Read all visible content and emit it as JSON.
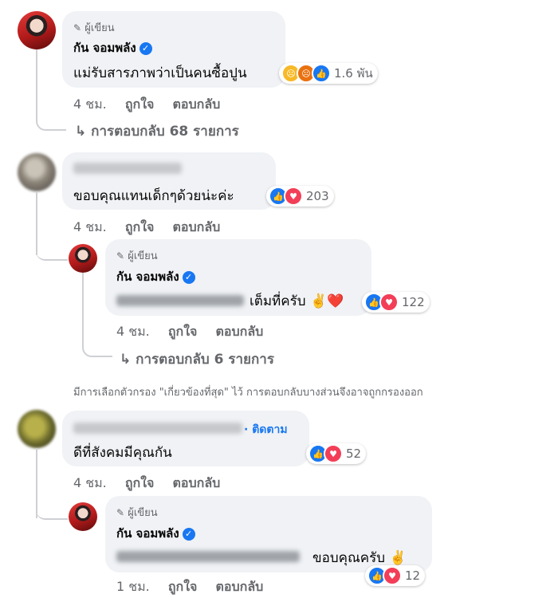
{
  "author_label": "ผู้เขียน",
  "page_name": "กัน จอมพลัง",
  "like_label": "ถูกใจ",
  "reply_label": "ตอบกลับ",
  "comment1": {
    "text": "แม่รับสารภาพว่าเป็นคนซื้อปูน",
    "time": "4 ชม.",
    "reactions_count": "1.6 พัน",
    "replies_link": "การตอบกลับ 68 รายการ"
  },
  "comment2": {
    "text": "ขอบคุณแทนเด็กๆด้วยน่ะค่ะ",
    "time": "4 ชม.",
    "reactions_count": "203",
    "reply": {
      "text": "เต็มที่ครับ ✌️❤️",
      "time": "4 ชม.",
      "reactions_count": "122",
      "replies_link": "การตอบกลับ 6 รายการ"
    }
  },
  "filter_note": "มีการเลือกตัวกรอง \"เกี่ยวข้องที่สุด\" ไว้ การตอบกลับบางส่วนจึงอาจถูกกรองออก",
  "comment3": {
    "follow_label": "ติดตาม",
    "text": "ดีที่สังคมมีคุณกัน",
    "time": "4 ชม.",
    "reactions_count": "52",
    "reply": {
      "text": "ขอบคุณครับ ✌️",
      "time": "1 ชม.",
      "reactions_count": "12"
    }
  }
}
